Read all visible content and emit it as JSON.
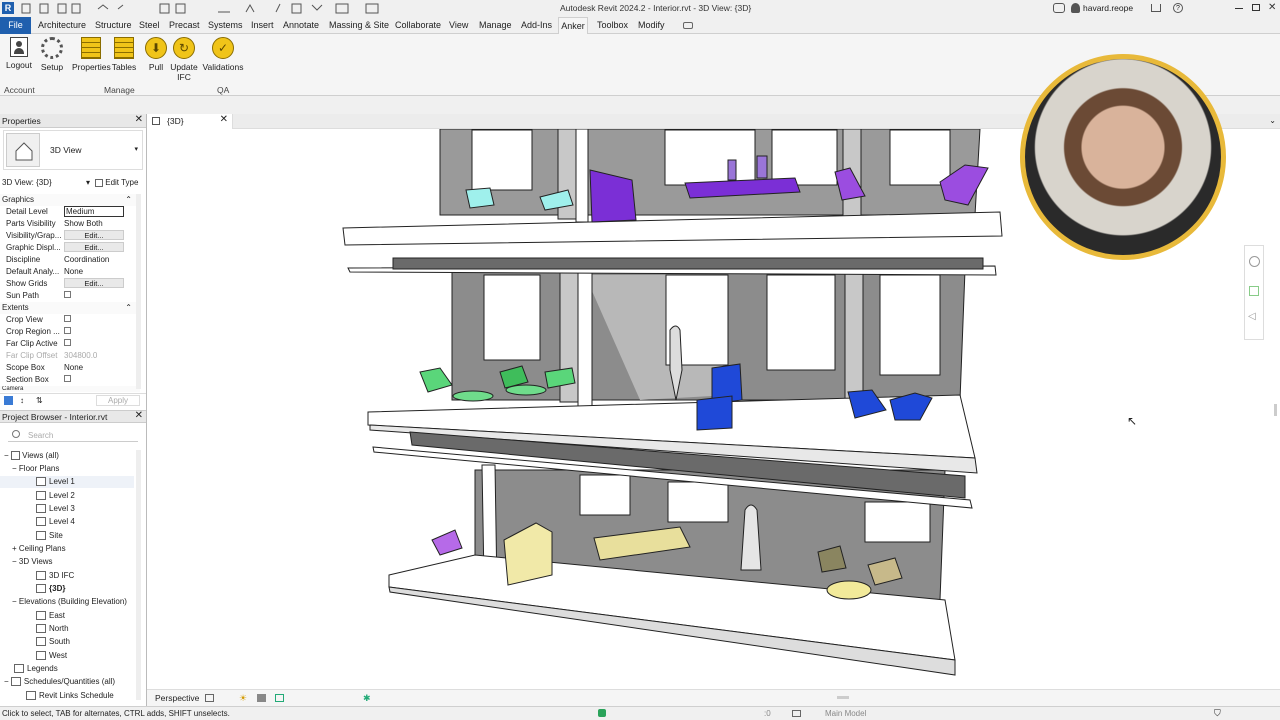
{
  "app": {
    "title": "Autodesk Revit 2024.2 - Interior.rvt - 3D View: {3D}",
    "user": "havard.reope"
  },
  "ribbon_tabs": [
    "File",
    "Architecture",
    "Structure",
    "Steel",
    "Precast",
    "Systems",
    "Insert",
    "Annotate",
    "Massing & Site",
    "Collaborate",
    "View",
    "Manage",
    "Add-Ins",
    "Anker",
    "Toolbox",
    "Modify"
  ],
  "ribbon": {
    "buttons": [
      {
        "label": "Logout"
      },
      {
        "label": "Setup"
      },
      {
        "label": "Properties"
      },
      {
        "label": "Tables"
      },
      {
        "label": "Pull"
      },
      {
        "label": "Update IFC"
      },
      {
        "label": "Validations"
      }
    ],
    "panels": [
      "Account",
      "Manage",
      "QA"
    ]
  },
  "properties": {
    "title": "Properties",
    "type_name": "3D View",
    "selector": "3D View: {3D}",
    "edit_type": "Edit Type",
    "sections": {
      "graphics": "Graphics",
      "extents": "Extents",
      "camera": "Camera"
    },
    "rows": [
      {
        "k": "Detail Level",
        "v": "Medium"
      },
      {
        "k": "Parts Visibility",
        "v": "Show Both"
      },
      {
        "k": "Visibility/Grap...",
        "v": "Edit..."
      },
      {
        "k": "Graphic Displ...",
        "v": "Edit..."
      },
      {
        "k": "Discipline",
        "v": "Coordination"
      },
      {
        "k": "Default Analy...",
        "v": "None"
      },
      {
        "k": "Show Grids",
        "v": "Edit..."
      },
      {
        "k": "Sun Path",
        "v": ""
      },
      {
        "k": "Crop View",
        "v": ""
      },
      {
        "k": "Crop Region ...",
        "v": ""
      },
      {
        "k": "Far Clip Active",
        "v": ""
      },
      {
        "k": "Far Clip Offset",
        "v": "304800.0"
      },
      {
        "k": "Scope Box",
        "v": "None"
      },
      {
        "k": "Section Box",
        "v": ""
      }
    ],
    "apply": "Apply"
  },
  "browser": {
    "title": "Project Browser - Interior.rvt",
    "search_placeholder": "Search",
    "items": [
      {
        "label": "Views (all)"
      },
      {
        "label": "Floor Plans"
      },
      {
        "label": "Level 1"
      },
      {
        "label": "Level 2"
      },
      {
        "label": "Level 3"
      },
      {
        "label": "Level 4"
      },
      {
        "label": "Site"
      },
      {
        "label": "Ceiling Plans"
      },
      {
        "label": "3D Views"
      },
      {
        "label": "3D IFC"
      },
      {
        "label": "{3D}"
      },
      {
        "label": "Elevations (Building Elevation)"
      },
      {
        "label": "East"
      },
      {
        "label": "North"
      },
      {
        "label": "South"
      },
      {
        "label": "West"
      },
      {
        "label": "Legends"
      },
      {
        "label": "Schedules/Quantities (all)"
      },
      {
        "label": "Revit Links Schedule"
      }
    ]
  },
  "view": {
    "tab_label": "{3D}",
    "mode": "Perspective"
  },
  "status": {
    "hint": "Click to select, TAB for alternates, CTRL adds, SHIFT unselects.",
    "worksets": ":0",
    "model": "Main Model"
  },
  "colors": {
    "ribbon_gold": "#f0c419",
    "purple": "#7b2fd6",
    "blue": "#1f49d8",
    "green": "#5ad67a",
    "cyan": "#9ff0ec",
    "khaki": "#e8df9c",
    "webcam_ring": "#e8b93a"
  }
}
